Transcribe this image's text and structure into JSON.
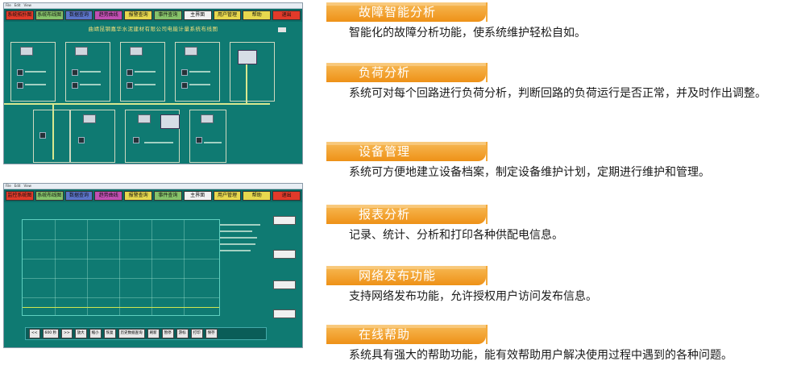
{
  "screenshot_top": {
    "nav": [
      {
        "label": "系统拓扑图",
        "bg": "#e23a2a"
      },
      {
        "label": "系统布线图",
        "bg": "#86c36a"
      },
      {
        "label": "数据查询",
        "bg": "#5b74c9"
      },
      {
        "label": "趋势曲线",
        "bg": "#c14fb3"
      },
      {
        "label": "报警查询",
        "bg": "#e7d84e"
      },
      {
        "label": "事件查询",
        "bg": "#86c36a"
      },
      {
        "label": "主界面",
        "bg": "#f1f1f1"
      },
      {
        "label": "用户管理",
        "bg": "#e7d84e"
      },
      {
        "label": "帮助",
        "bg": "#e7d84e"
      },
      {
        "label": "退出",
        "bg": "#e23a2a"
      }
    ],
    "title": "曲靖昆钢嘉华水泥建材有限公司电能计量系统布线图"
  },
  "screenshot_bottom": {
    "nav": [
      {
        "label": "监控系统图",
        "bg": "#e23a2a"
      },
      {
        "label": "系统布线图",
        "bg": "#86c36a"
      },
      {
        "label": "数据查询",
        "bg": "#5b74c9"
      },
      {
        "label": "趋势曲线",
        "bg": "#c14fb3"
      },
      {
        "label": "报警查询",
        "bg": "#e7d84e"
      },
      {
        "label": "事件查询",
        "bg": "#86c36a"
      },
      {
        "label": "主界面",
        "bg": "#f1f1f1"
      },
      {
        "label": "用户管理",
        "bg": "#e7d84e"
      },
      {
        "label": "帮助",
        "bg": "#e7d84e"
      },
      {
        "label": "退出",
        "bg": "#e23a2a"
      }
    ],
    "bottom_buttons": [
      "<<",
      "600 秒",
      ">>",
      "放大",
      "缩小",
      "恢复",
      "历史数据查询",
      "刷新",
      "暂停",
      "游标",
      "打印",
      "保存"
    ]
  },
  "sections": [
    {
      "title": "故障智能分析",
      "text": "智能化的故障分析功能，使系统维护轻松自如。"
    },
    {
      "title": "负荷分析",
      "text": "系统可对每个回路进行负荷分析，判断回路的负荷运行是否正常，并及时作出调整。"
    },
    {
      "title": "设备管理",
      "text": "系统可方便地建立设备档案，制定设备维护计划，定期进行维护和管理。"
    },
    {
      "title": "报表分析",
      "text": "记录、统计、分析和打印各种供配电信息。"
    },
    {
      "title": "网络发布功能",
      "text": "支持网络发布功能，允许授权用户访问发布信息。"
    },
    {
      "title": "在线帮助",
      "text": "系统具有强大的帮助功能，能有效帮助用户解决使用过程中遇到的各种问题。"
    }
  ]
}
